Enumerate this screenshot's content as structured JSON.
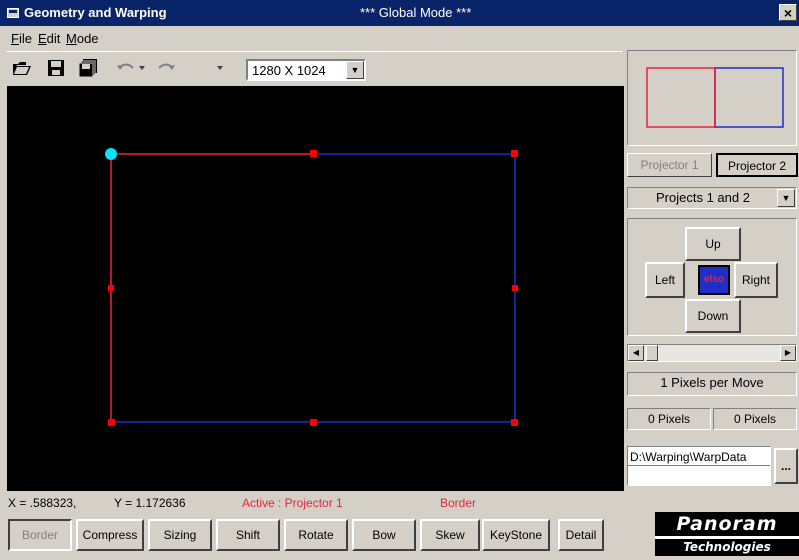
{
  "window": {
    "title": "Geometry and Warping",
    "mode_title": "*** Global Mode ***",
    "close_label": "×"
  },
  "menu": {
    "items": [
      "File",
      "Edit",
      "Mode"
    ]
  },
  "toolbar": {
    "icons": [
      "open-icon",
      "save-icon",
      "save-all-icon",
      "undo-icon",
      "redo-icon"
    ],
    "resolution": "1280 X 1024"
  },
  "canvas": {
    "left_edge_color": "#e8243a",
    "other_edge_color": "#1f2ec7",
    "handle_color": "#ff0000",
    "active_handle_color": "#00e5ff"
  },
  "panel": {
    "projector1_label": "Projector 1",
    "projector2_label": "Projector 2",
    "projects_select": "Projects 1 and 2",
    "up": "Up",
    "left": "Left",
    "right": "Right",
    "down": "Down",
    "center": "elso",
    "pixels_per_move": "1 Pixels per Move",
    "pixels_x": "0 Pixels",
    "pixels_y": "0 Pixels",
    "data_path": "D:\\Warping\\WarpData",
    "browse_label": "..."
  },
  "status": {
    "x": "X = .588323,",
    "y": "Y = 1.172636",
    "active": "Active : Projector 1",
    "mode": "Border"
  },
  "buttons": {
    "border": "Border",
    "compress": "Compress",
    "sizing": "Sizing",
    "shift": "Shift",
    "rotate": "Rotate",
    "bow": "Bow",
    "skew": "Skew",
    "keystone": "KeyStone",
    "detail": "Detail"
  },
  "logo": {
    "top": "Panoram",
    "bottom": "Technologies"
  }
}
